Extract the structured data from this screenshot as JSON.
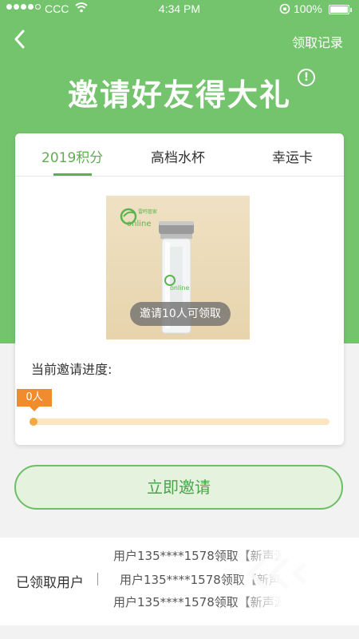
{
  "status_bar": {
    "carrier": "CCC",
    "time": "4:34 PM",
    "battery": "100%"
  },
  "nav": {
    "records_link": "领取记录"
  },
  "header": {
    "title": "邀请好友得大礼",
    "info_icon": "!"
  },
  "tabs": [
    {
      "label": "2019积分",
      "active": true
    },
    {
      "label": "高档水杯",
      "active": false
    },
    {
      "label": "幸运卡",
      "active": false
    }
  ],
  "reward": {
    "product_icon": "water-bottle-icon",
    "brand_small": "online",
    "badge": "邀请10人可领取"
  },
  "progress": {
    "label": "当前邀请进度:",
    "current": "0人",
    "fraction": 0.0
  },
  "actions": {
    "invite": "立即邀请"
  },
  "claimed": {
    "label": "已领取用户",
    "entries": [
      "用户135****1578领取【新声源】",
      "用户135****1578领取【新声源】",
      "用户135****1578领取【新声源】"
    ]
  },
  "colors": {
    "hero_green": "#74c46e",
    "accent_green": "#5fae4f",
    "progress_orange": "#f08c2d"
  }
}
